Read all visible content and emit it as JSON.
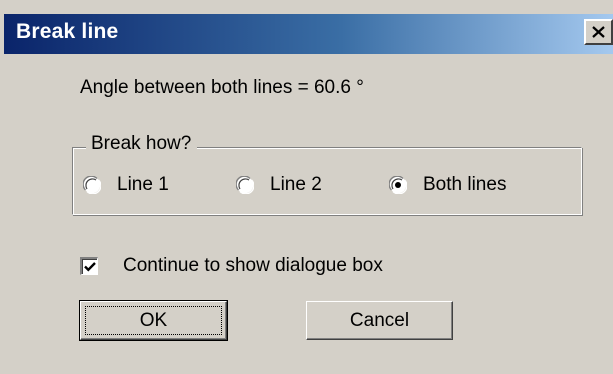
{
  "window": {
    "title": "Break line",
    "close_symbol": "close-icon"
  },
  "info": {
    "angle_text": "Angle between both lines = 60.6 °"
  },
  "break_group": {
    "legend": "Break how?",
    "options": [
      {
        "label": "Line 1",
        "selected": false
      },
      {
        "label": "Line 2",
        "selected": false
      },
      {
        "label": "Both lines",
        "selected": true
      }
    ]
  },
  "continue_checkbox": {
    "label": "Continue to show dialogue box",
    "checked": true
  },
  "buttons": {
    "ok_label": "OK",
    "cancel_label": "Cancel"
  },
  "colors": {
    "dialog_face": "#d4d0c8",
    "titlebar_start": "#0a246a",
    "titlebar_end": "#a6caf0"
  }
}
